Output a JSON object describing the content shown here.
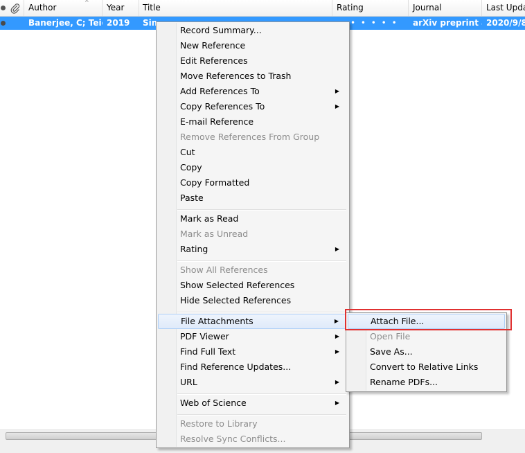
{
  "table": {
    "columns": {
      "attachment_icon": "paperclip-icon",
      "author": "Author",
      "year": "Year",
      "title": "Title",
      "rating": "Rating",
      "journal": "Journal",
      "last_updated": "Last Updat"
    },
    "selected_row": {
      "author": "Banerjee, C; Teic...",
      "year": "2019",
      "title": "Sin",
      "rating": "• • • • •",
      "journal": "arXiv preprint a...",
      "last_updated": "2020/9/8"
    }
  },
  "context_menu": {
    "items": [
      {
        "label": "Record Summary...",
        "disabled": false,
        "submenu": false
      },
      {
        "label": "New Reference",
        "disabled": false,
        "submenu": false
      },
      {
        "label": "Edit References",
        "disabled": false,
        "submenu": false
      },
      {
        "label": "Move References to Trash",
        "disabled": false,
        "submenu": false
      },
      {
        "label": "Add References To",
        "disabled": false,
        "submenu": true
      },
      {
        "label": "Copy References To",
        "disabled": false,
        "submenu": true
      },
      {
        "label": "E-mail Reference",
        "disabled": false,
        "submenu": false
      },
      {
        "label": "Remove References From Group",
        "disabled": true,
        "submenu": false
      },
      {
        "label": "Cut",
        "disabled": false,
        "submenu": false
      },
      {
        "label": "Copy",
        "disabled": false,
        "submenu": false
      },
      {
        "label": "Copy Formatted",
        "disabled": false,
        "submenu": false
      },
      {
        "label": "Paste",
        "disabled": false,
        "submenu": false
      },
      {
        "label": "Mark as Read",
        "disabled": false,
        "submenu": false
      },
      {
        "label": "Mark as Unread",
        "disabled": true,
        "submenu": false
      },
      {
        "label": "Rating",
        "disabled": false,
        "submenu": true
      },
      {
        "label": "Show All References",
        "disabled": true,
        "submenu": false
      },
      {
        "label": "Show Selected References",
        "disabled": false,
        "submenu": false
      },
      {
        "label": "Hide Selected References",
        "disabled": false,
        "submenu": false
      },
      {
        "label": "File Attachments",
        "disabled": false,
        "submenu": true
      },
      {
        "label": "PDF Viewer",
        "disabled": false,
        "submenu": true
      },
      {
        "label": "Find Full Text",
        "disabled": false,
        "submenu": true
      },
      {
        "label": "Find Reference Updates...",
        "disabled": false,
        "submenu": false
      },
      {
        "label": "URL",
        "disabled": false,
        "submenu": true
      },
      {
        "label": "Web of Science",
        "disabled": false,
        "submenu": true
      },
      {
        "label": "Restore to Library",
        "disabled": true,
        "submenu": false
      },
      {
        "label": "Resolve Sync Conflicts...",
        "disabled": true,
        "submenu": false
      }
    ],
    "submenu_arrow": "▶"
  },
  "file_attachments_submenu": {
    "items": [
      {
        "label": "Attach File...",
        "disabled": false
      },
      {
        "label": "Open File",
        "disabled": true
      },
      {
        "label": "Save As...",
        "disabled": false
      },
      {
        "label": "Convert to Relative Links",
        "disabled": false
      },
      {
        "label": "Rename PDFs...",
        "disabled": false
      }
    ]
  },
  "colors": {
    "selection": "#3399ff",
    "highlight_box": "#e03030"
  }
}
